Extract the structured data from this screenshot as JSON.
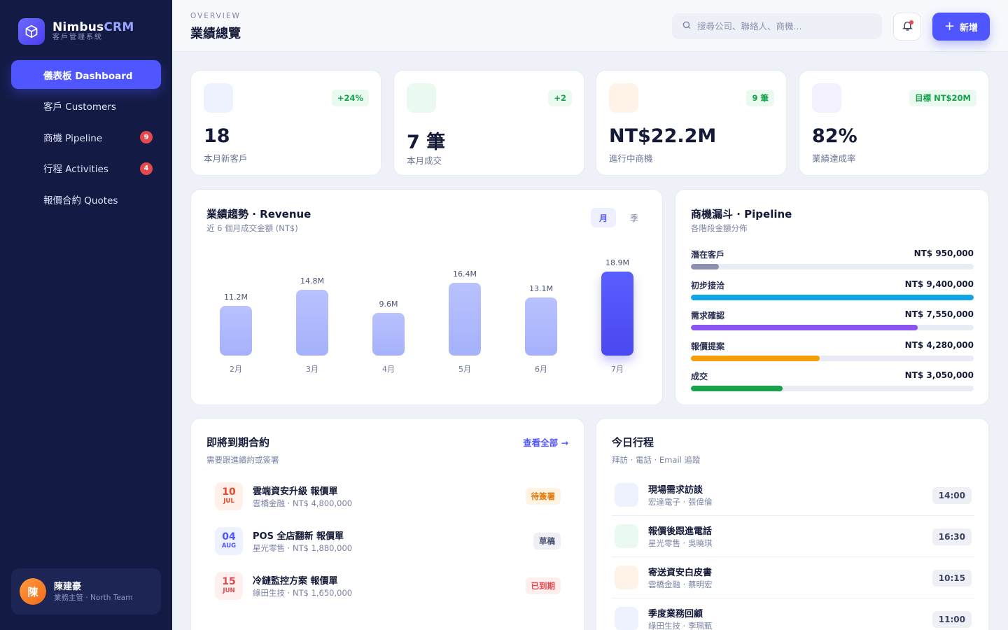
{
  "brand": {
    "name_main": "Nimbus",
    "name_accent": "CRM",
    "subtitle": "客戶管理系統"
  },
  "nav": [
    {
      "label": "儀表板 Dashboard",
      "active": true,
      "badge": null
    },
    {
      "label": "客戶 Customers",
      "active": false,
      "badge": null
    },
    {
      "label": "商機 Pipeline",
      "active": false,
      "badge": "9"
    },
    {
      "label": "行程 Activities",
      "active": false,
      "badge": "4"
    },
    {
      "label": "報價合約 Quotes",
      "active": false,
      "badge": null
    }
  ],
  "user": {
    "initial": "陳",
    "name": "陳建豪",
    "role": "業務主管 · North Team"
  },
  "header": {
    "overline": "OVERVIEW",
    "title": "業績總覽",
    "search_placeholder": "搜尋公司、聯絡人、商機...",
    "add_label": "新增"
  },
  "kpis": [
    {
      "value": "18",
      "label": "本月新客戶",
      "pill": "+24%",
      "icon_color": "#eef2ff"
    },
    {
      "value": "7 筆",
      "label": "本月成交",
      "pill": "+2",
      "icon_color": "#eafaf0"
    },
    {
      "value": "NT$22.2M",
      "label": "進行中商機",
      "pill": "9 筆",
      "icon_color": "#fff3e8"
    },
    {
      "value": "82%",
      "label": "業績達成率",
      "pill": "目標 NT$20M",
      "icon_color": "#f3f0ff"
    }
  ],
  "revenue": {
    "title": "業績趨勢 · Revenue",
    "subtitle": "近 6 個月成交金額 (NT$)",
    "toggle": [
      "月",
      "季"
    ]
  },
  "chart_data": {
    "type": "bar",
    "categories": [
      "2月",
      "3月",
      "4月",
      "5月",
      "6月",
      "7月"
    ],
    "values": [
      11.2,
      14.8,
      9.6,
      16.4,
      13.1,
      18.9
    ],
    "value_labels": [
      "11.2M",
      "14.8M",
      "9.6M",
      "16.4M",
      "13.1M",
      "18.9M"
    ],
    "highlight_index": 5,
    "ylim": [
      0,
      18.9
    ]
  },
  "pipeline": {
    "title": "商機漏斗 · Pipeline",
    "subtitle": "各階段金額分佈",
    "stages": [
      {
        "name": "潛在客戶",
        "amount": "NT$ 950,000",
        "fraction": 0.1,
        "color": "#8a90ad"
      },
      {
        "name": "初步接洽",
        "amount": "NT$ 9,400,000",
        "fraction": 1.0,
        "color": "#12a6e8"
      },
      {
        "name": "需求確認",
        "amount": "NT$ 7,550,000",
        "fraction": 0.803,
        "color": "#8b55ef"
      },
      {
        "name": "報價提案",
        "amount": "NT$ 4,280,000",
        "fraction": 0.455,
        "color": "#f59e0b"
      },
      {
        "name": "成交",
        "amount": "NT$ 3,050,000",
        "fraction": 0.324,
        "color": "#16a34a"
      }
    ]
  },
  "quotes": {
    "title": "即將到期合約",
    "subtitle": "需要跟進續約或簽署",
    "link": "查看全部 →",
    "items": [
      {
        "day": "10",
        "month": "JUL",
        "name": "雲端資安升級 報價單",
        "meta": "雲橋金融 · NT$ 4,800,000",
        "status": "待簽署",
        "tone": "warn"
      },
      {
        "day": "04",
        "month": "AUG",
        "name": "POS 全店翻新 報價單",
        "meta": "星光零售 · NT$ 1,880,000",
        "status": "草稿",
        "tone": "draft"
      },
      {
        "day": "15",
        "month": "JUN",
        "name": "冷鏈監控方案 報價單",
        "meta": "綠田生技 · NT$ 1,650,000",
        "status": "已到期",
        "tone": "expired"
      }
    ]
  },
  "schedule": {
    "title": "今日行程",
    "subtitle": "拜訪 · 電話 · Email 追蹤",
    "items": [
      {
        "title": "現場需求訪談",
        "meta": "宏達電子 · 張偉倫",
        "time": "14:00",
        "color": "#eef2ff"
      },
      {
        "title": "報價後跟進電話",
        "meta": "星光零售 · 吳曉琪",
        "time": "16:30",
        "color": "#eafaf0"
      },
      {
        "title": "寄送資安白皮書",
        "meta": "雲橋金融 · 蔡明宏",
        "time": "10:15",
        "color": "#fff3e8"
      },
      {
        "title": "季度業務回顧",
        "meta": "綠田生技 · 李珮甄",
        "time": "11:00",
        "color": "#eef2ff"
      }
    ]
  }
}
